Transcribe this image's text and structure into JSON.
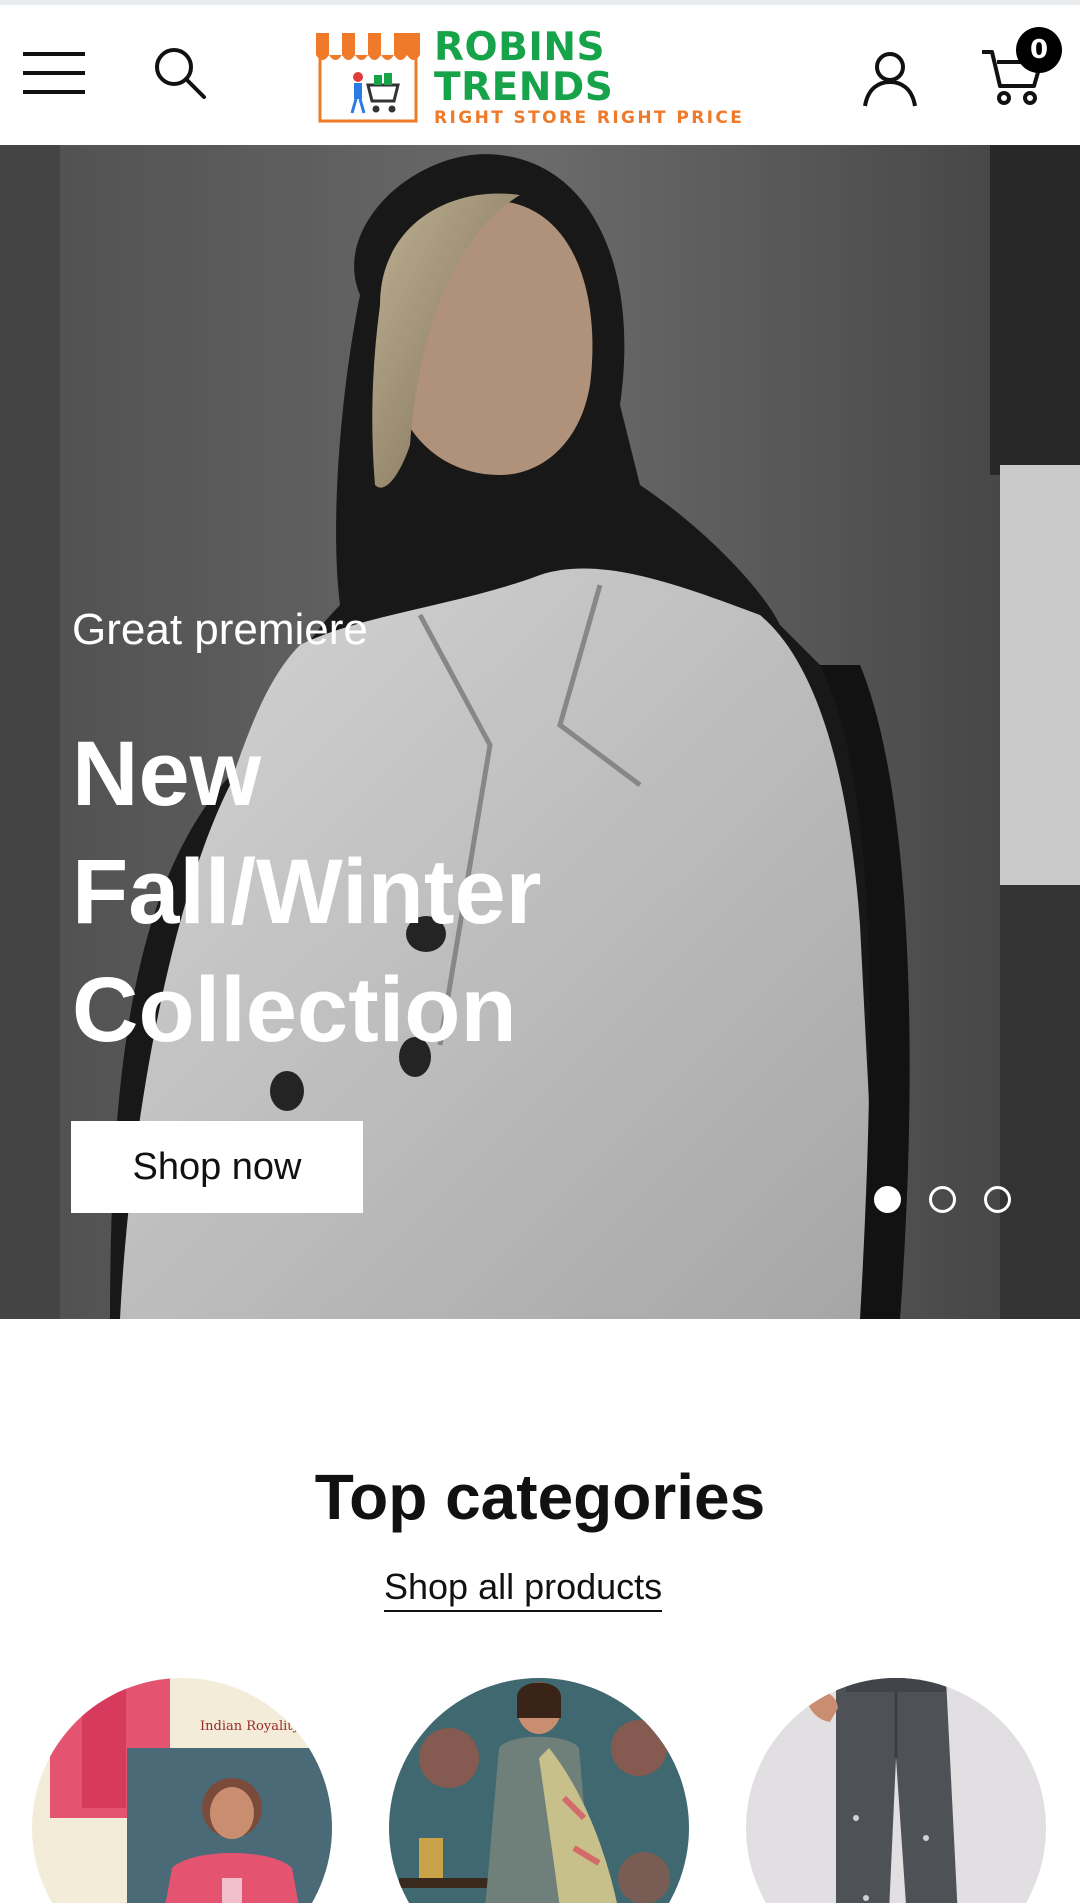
{
  "header": {
    "logo": {
      "name": "ROBINS TRENDS",
      "tagline": "RIGHT STORE RIGHT PRICE"
    },
    "icons": {
      "menu": "menu-icon",
      "search": "search-icon",
      "account": "user-icon",
      "cart": "cart-icon"
    },
    "cart_count": "0",
    "colors": {
      "logo_green": "#17a34a",
      "logo_orange": "#ef7a2a"
    }
  },
  "hero": {
    "eyebrow": "Great premiere",
    "title": "New Fall/Winter Collection",
    "cta_label": "Shop now",
    "slides_total": 3,
    "active_slide": 1
  },
  "categories": {
    "title": "Top categories",
    "shop_all_label": "Shop all products",
    "items": [
      {
        "image": "embroidered-kurta-set-image",
        "logo_text": "Indian Royality"
      },
      {
        "image": "printed-suit-dupatta-image"
      },
      {
        "image": "grey-jeans-image"
      }
    ]
  }
}
